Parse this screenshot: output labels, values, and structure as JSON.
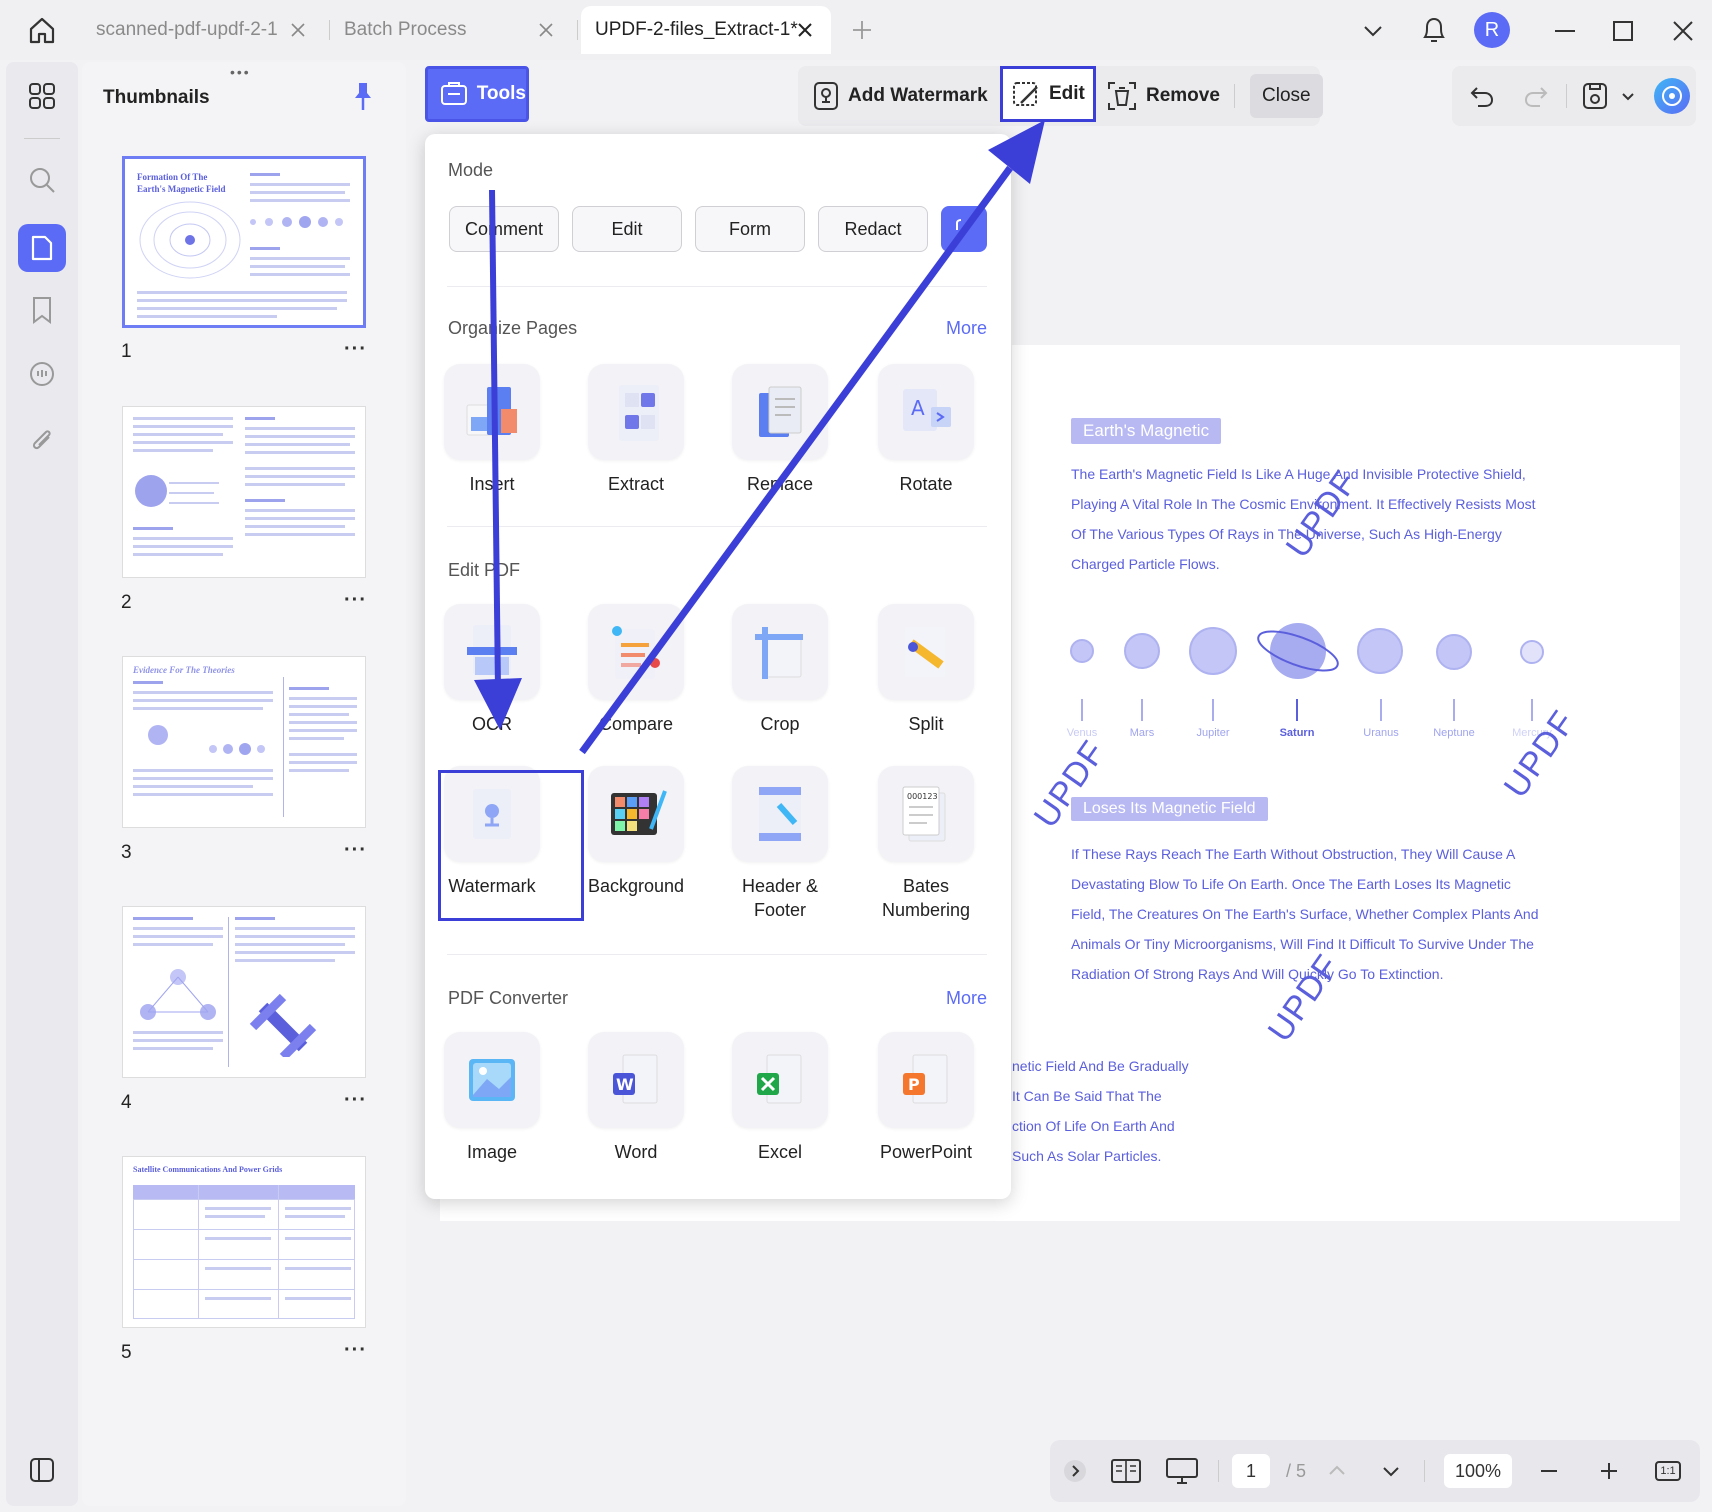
{
  "tabs": [
    {
      "label": "scanned-pdf-updf-2-1"
    },
    {
      "label": "Batch Process"
    },
    {
      "label": "UPDF-2-files_Extract-1*"
    }
  ],
  "window": {
    "avatar_letter": "R"
  },
  "thumbnails": {
    "title": "Thumbnails",
    "pages": [
      {
        "num": "1",
        "more": "···",
        "heading": "Formation Of The Earth's Magnetic Field"
      },
      {
        "num": "2",
        "more": "···",
        "heading": ""
      },
      {
        "num": "3",
        "more": "···",
        "heading": "Evidence For The Theories"
      },
      {
        "num": "4",
        "more": "···",
        "heading": ""
      },
      {
        "num": "5",
        "more": "···",
        "heading": "Satellite Communications And Power Grids"
      }
    ]
  },
  "toolbar": {
    "tools_label": "Tools",
    "add_watermark": "Add Watermark",
    "edit": "Edit",
    "remove": "Remove",
    "close": "Close"
  },
  "menu": {
    "mode_title": "Mode",
    "modes": [
      "Comment",
      "Edit",
      "Form",
      "Redact"
    ],
    "organize_title": "Organize Pages",
    "organize_more": "More",
    "organize_tools": [
      "Insert",
      "Extract",
      "Replace",
      "Rotate"
    ],
    "edit_title": "Edit PDF",
    "edit_tools": [
      "OCR",
      "Compare",
      "Crop",
      "Split"
    ],
    "edit_tools2": [
      "Watermark",
      "Background",
      "Header & Footer",
      "Bates Numbering"
    ],
    "converter_title": "PDF Converter",
    "converter_more": "More",
    "converter_tools": [
      "Image",
      "Word",
      "Excel",
      "PowerPoint"
    ]
  },
  "document": {
    "badge1": "Earth's Magnetic",
    "para1": [
      "The Earth's Magnetic Field Is Like A Huge And Invisible Protective Shield,",
      "Playing A Vital Role In The Cosmic Environment. It Effectively Resists Most",
      "Of The Various Types Of Rays in The Universe, Such As High-Energy",
      "Charged Particle Flows."
    ],
    "planets": [
      "Venus",
      "Mars",
      "Jupiter",
      "Saturn",
      "Uranus",
      "Neptune",
      "Mercury"
    ],
    "badge2": "Loses Its Magnetic Field",
    "para2": [
      "If These Rays Reach The Earth Without Obstruction, They Will Cause A",
      "Devastating Blow To Life On Earth. Once The Earth Loses Its Magnetic",
      "Field, The Creatures On The Earth's Surface, Whether Complex Plants And",
      "Animals Or Tiny Microorganisms, Will Find It Difficult To Survive Under The",
      "Radiation Of Strong Rays And Will Quickly Go To Extinction."
    ],
    "para3": [
      "netic Field And Be Gradually",
      "It Can Be Said That The",
      "ction Of Life On Earth And",
      " Such As Solar Particles."
    ],
    "watermark_text": "UPDF"
  },
  "bottombar": {
    "page_current": "1",
    "page_total": "/ 5",
    "zoom": "100%",
    "fit": "1:1"
  },
  "colors": {
    "accent": "#5b6bf5",
    "highlight": "#3b3fd8",
    "doc_text": "#5b5fdc"
  }
}
